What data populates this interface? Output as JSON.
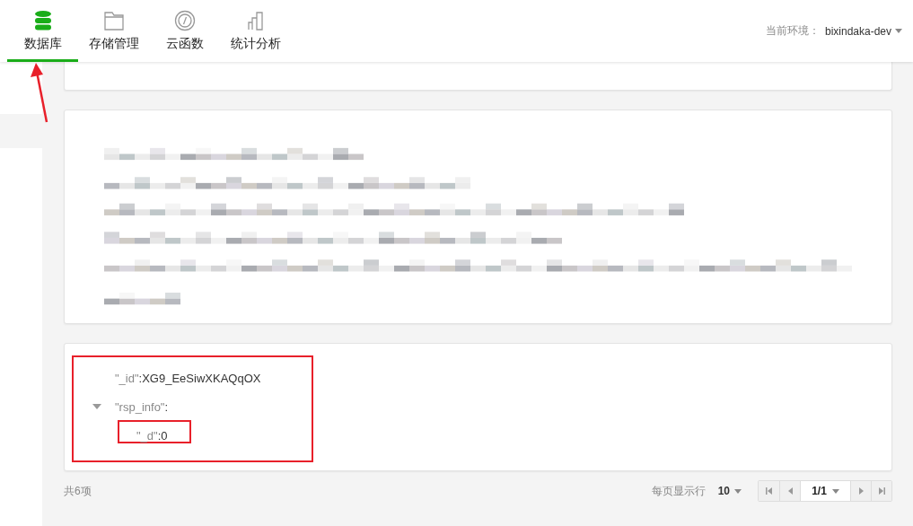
{
  "tabs": [
    {
      "label": "数据库",
      "selected": true,
      "kind": "database"
    },
    {
      "label": "存储管理",
      "selected": false,
      "kind": "folder"
    },
    {
      "label": "云函数",
      "selected": false,
      "kind": "function"
    },
    {
      "label": "统计分析",
      "selected": false,
      "kind": "chart"
    }
  ],
  "environment": {
    "label": "当前环境：",
    "value": "bixindaka-dev"
  },
  "record": {
    "fields": [
      {
        "key": "\"_id\"",
        "separator": ":",
        "value": "XG9_EeSiwXKAQqOX"
      },
      {
        "key": "\"rsp_info\"",
        "separator": ":",
        "expanded": true,
        "children": [
          {
            "key": "\"_d\"",
            "separator": ":",
            "value": "0"
          }
        ]
      }
    ]
  },
  "footer": {
    "total": "共6项",
    "page_size_label": "每页显示行",
    "page_size": "10",
    "page": "1/1"
  }
}
